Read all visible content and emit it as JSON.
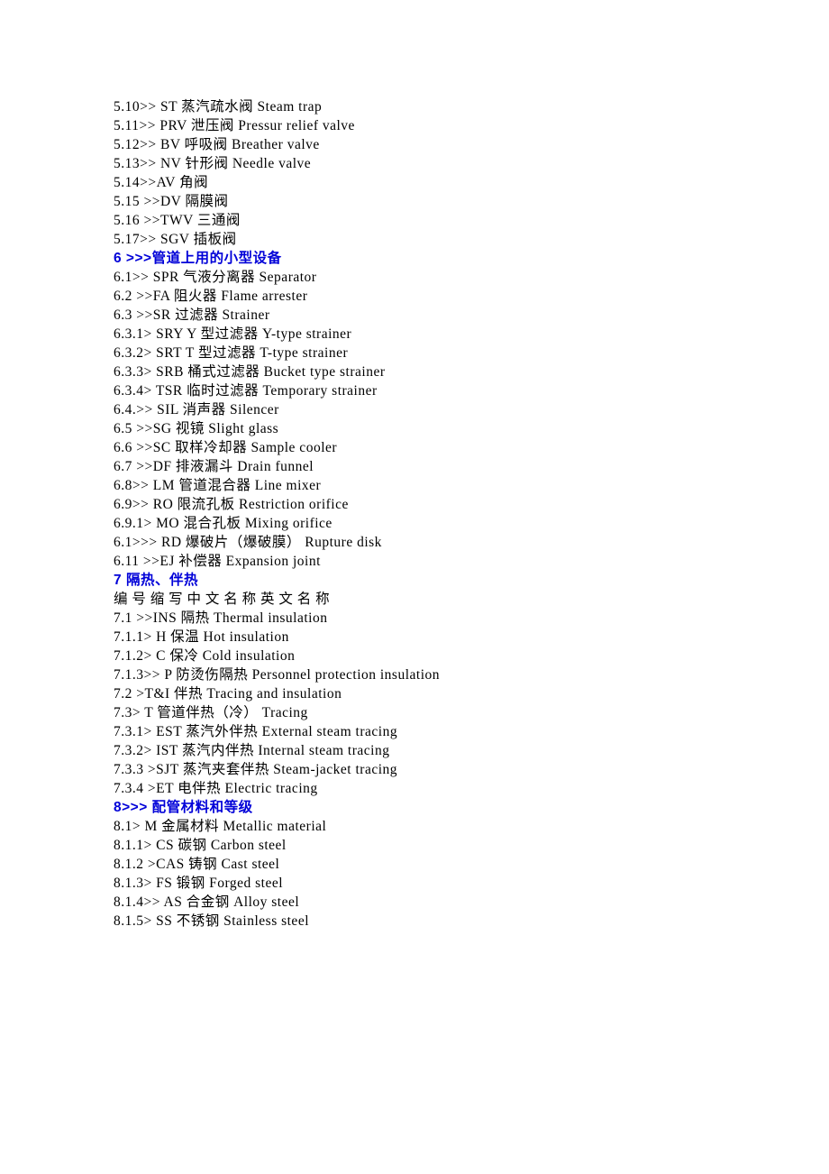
{
  "lines": [
    {
      "type": "line",
      "text": "5.10>> ST 蒸汽疏水阀 Steam trap"
    },
    {
      "type": "line",
      "text": "5.11>> PRV 泄压阀 Pressur relief valve"
    },
    {
      "type": "line",
      "text": "5.12>> BV 呼吸阀 Breather valve"
    },
    {
      "type": "line",
      "text": "5.13>> NV 针形阀 Needle valve"
    },
    {
      "type": "line",
      "text": "5.14>>AV 角阀"
    },
    {
      "type": "line",
      "text": "5.15 >>DV 隔膜阀"
    },
    {
      "type": "line",
      "text": "5.16 >>TWV 三通阀"
    },
    {
      "type": "line",
      "text": "5.17>> SGV 插板阀"
    },
    {
      "type": "heading",
      "num": "6 >>>",
      "text": "管道上用的小型设备"
    },
    {
      "type": "line",
      "text": "6.1>> SPR 气液分离器 Separator"
    },
    {
      "type": "line",
      "text": "6.2 >>FA 阻火器 Flame arrester"
    },
    {
      "type": "line",
      "text": "6.3 >>SR 过滤器 Strainer"
    },
    {
      "type": "line",
      "text": "6.3.1> SRY Y 型过滤器 Y-type strainer"
    },
    {
      "type": "line",
      "text": "6.3.2> SRT T 型过滤器 T-type strainer"
    },
    {
      "type": "line",
      "text": "6.3.3> SRB 桶式过滤器 Bucket type strainer"
    },
    {
      "type": "line",
      "text": "6.3.4> TSR 临时过滤器 Temporary strainer"
    },
    {
      "type": "line",
      "text": "6.4.>> SIL 消声器 Silencer"
    },
    {
      "type": "line",
      "text": "6.5 >>SG 视镜 Slight glass"
    },
    {
      "type": "line",
      "text": "6.6 >>SC 取样冷却器 Sample cooler"
    },
    {
      "type": "line",
      "text": "6.7 >>DF 排液漏斗 Drain funnel"
    },
    {
      "type": "line",
      "text": "6.8>> LM 管道混合器 Line mixer"
    },
    {
      "type": "line",
      "text": "6.9>> RO 限流孔板 Restriction orifice"
    },
    {
      "type": "line",
      "text": "6.9.1> MO 混合孔板 Mixing orifice"
    },
    {
      "type": "line",
      "text": "6.1>>> RD 爆破片（爆破膜） Rupture disk"
    },
    {
      "type": "line",
      "text": "6.11 >>EJ 补偿器 Expansion joint"
    },
    {
      "type": "heading",
      "num": "7 ",
      "text": "隔热、伴热"
    },
    {
      "type": "line",
      "text": "编 号 缩 写 中 文 名 称 英 文 名 称"
    },
    {
      "type": "line",
      "text": "7.1 >>INS 隔热 Thermal insulation"
    },
    {
      "type": "line",
      "text": "7.1.1> H 保温 Hot insulation"
    },
    {
      "type": "line",
      "text": "7.1.2> C 保冷 Cold insulation"
    },
    {
      "type": "line",
      "text": "7.1.3>> P 防烫伤隔热 Personnel protection insulation"
    },
    {
      "type": "line",
      "text": "7.2 >T&I 伴热 Tracing and insulation"
    },
    {
      "type": "line",
      "text": "7.3> T 管道伴热（冷） Tracing"
    },
    {
      "type": "line",
      "text": "7.3.1> EST 蒸汽外伴热 External steam tracing"
    },
    {
      "type": "line",
      "text": "7.3.2> IST 蒸汽内伴热 Internal steam tracing"
    },
    {
      "type": "line",
      "text": "7.3.3 >SJT 蒸汽夹套伴热 Steam-jacket tracing"
    },
    {
      "type": "line",
      "text": "7.3.4 >ET 电伴热 Electric tracing"
    },
    {
      "type": "heading",
      "num": "8>>> ",
      "text": "配管材料和等级"
    },
    {
      "type": "line",
      "text": "8.1> M 金属材料 Metallic material"
    },
    {
      "type": "line",
      "text": "8.1.1> CS 碳钢 Carbon steel"
    },
    {
      "type": "line",
      "text": "8.1.2 >CAS 铸钢 Cast steel"
    },
    {
      "type": "line",
      "text": "8.1.3> FS 锻钢 Forged steel"
    },
    {
      "type": "line",
      "text": "8.1.4>> AS 合金钢 Alloy steel"
    },
    {
      "type": "line",
      "text": "8.1.5> SS 不锈钢 Stainless steel"
    }
  ]
}
